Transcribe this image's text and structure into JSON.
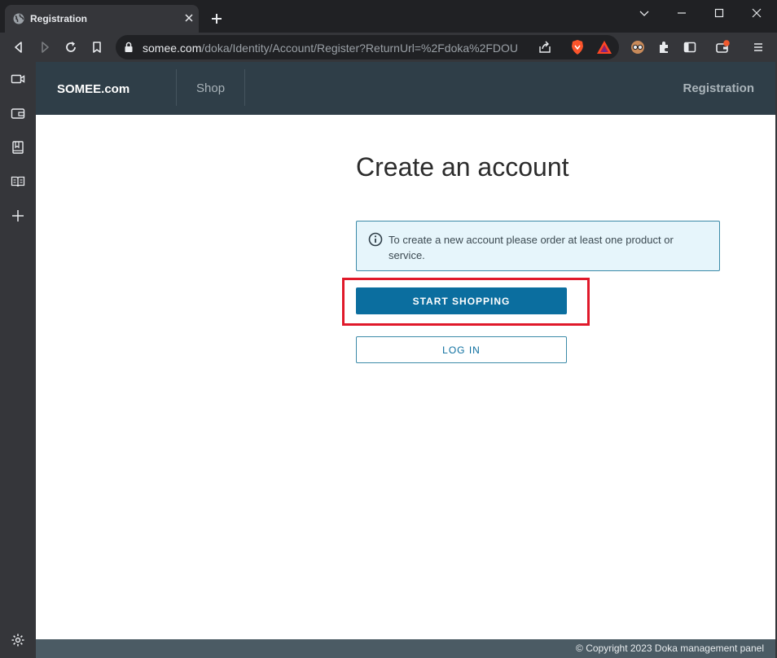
{
  "browser": {
    "tab_title": "Registration",
    "url_host": "somee.com",
    "url_path": "/doka/Identity/Account/Register?ReturnUrl=%2Fdoka%2FDOU"
  },
  "site": {
    "brand": "SOMEE.com",
    "nav_shop": "Shop",
    "nav_registration": "Registration"
  },
  "main": {
    "heading": "Create an account",
    "alert_text": "To create a new account please order at least one product or service.",
    "start_shopping_label": "START SHOPPING",
    "log_in_label": "LOG IN"
  },
  "footer": {
    "copyright": "© Copyright 2023 Doka management panel"
  },
  "colors": {
    "header_bg": "#2f3e48",
    "primary_button": "#0b6e9f",
    "alert_bg": "#e6f5fb",
    "highlight": "#e0192a",
    "footer_bg": "#4b5b64"
  }
}
